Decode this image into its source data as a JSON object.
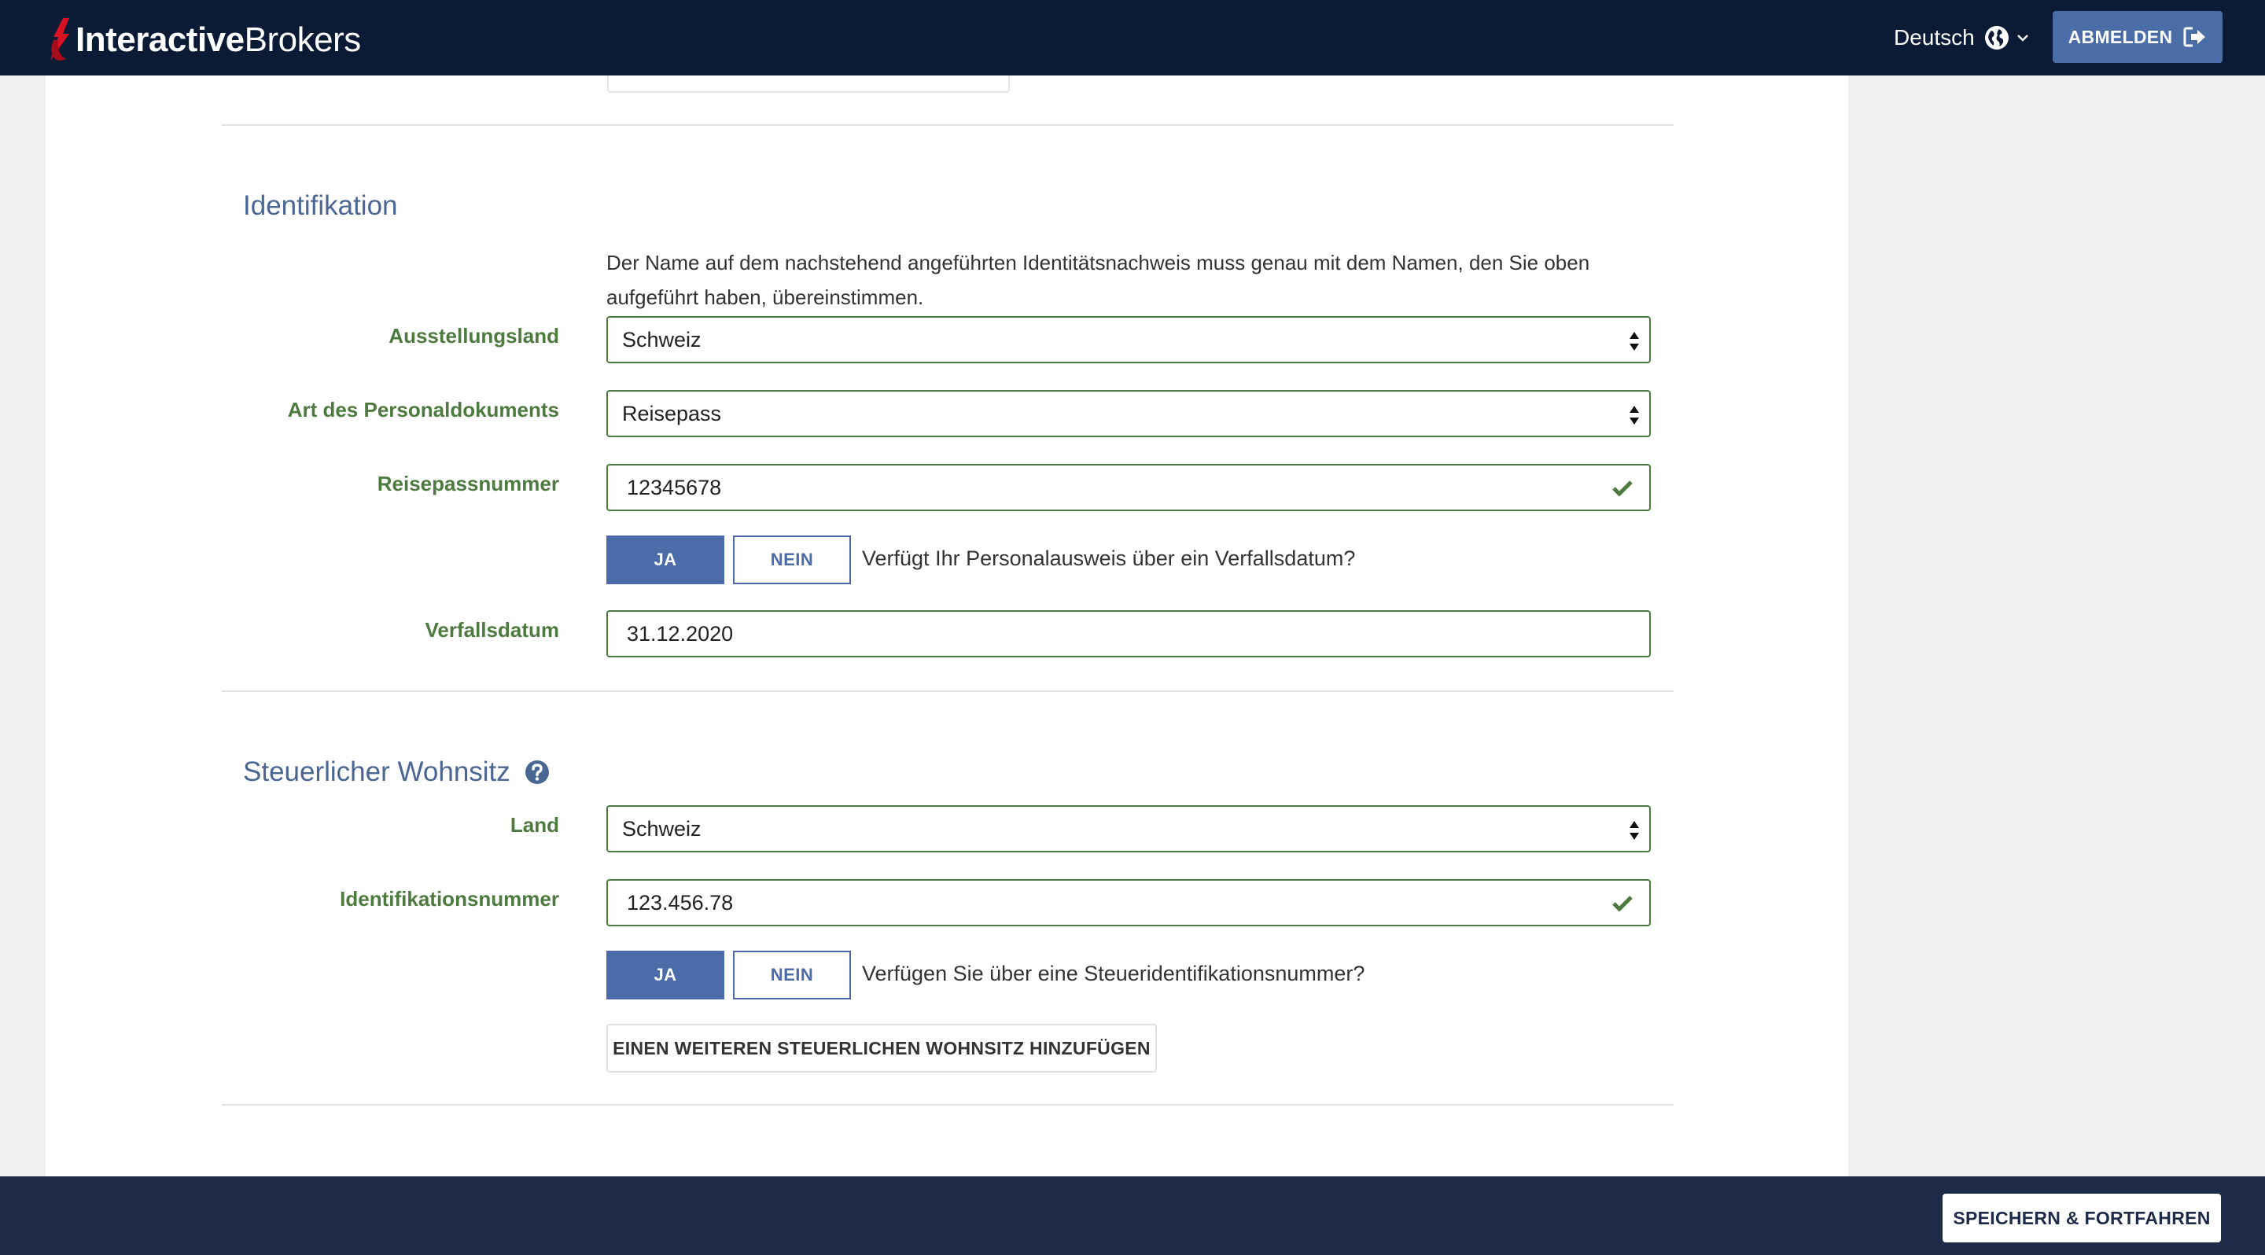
{
  "header": {
    "logo_bold": "Interactive",
    "logo_regular": "Brokers",
    "language": "Deutsch",
    "logout_label": "ABMELDEN"
  },
  "identification": {
    "title": "Identifikation",
    "intro": "Der Name auf dem nachstehend angeführten Identitätsnachweis muss genau mit dem Namen, den Sie oben aufgeführt haben, übereinstimmen.",
    "issuing_country": {
      "label": "Ausstellungsland",
      "value": "Schweiz"
    },
    "document_type": {
      "label": "Art des Personaldokuments",
      "value": "Reisepass"
    },
    "passport_number": {
      "label": "Reisepassnummer",
      "value": "12345678"
    },
    "has_expiry": {
      "yes": "JA",
      "no": "NEIN",
      "question": "Verfügt Ihr Personalausweis über ein Verfallsdatum?",
      "selected": "yes"
    },
    "expiry_date": {
      "label": "Verfallsdatum",
      "value": "31.12.2020"
    }
  },
  "tax_residency": {
    "title": "Steuerlicher Wohnsitz",
    "country": {
      "label": "Land",
      "value": "Schweiz"
    },
    "tin": {
      "label": "Identifikationsnummer",
      "value": "123.456.78"
    },
    "has_tin": {
      "yes": "JA",
      "no": "NEIN",
      "question": "Verfügen Sie über eine Steueridentifikationsnummer?",
      "selected": "yes"
    },
    "add_button": "EINEN WEITEREN STEUERLICHEN WOHNSITZ HINZUFÜGEN"
  },
  "footer": {
    "save_label": "SPEICHERN & FORTFAHREN"
  },
  "colors": {
    "nav_bg": "#0b1a35",
    "footer_bg": "#1d2b48",
    "accent_blue": "#4b6ca8",
    "label_green": "#4d7a3e",
    "logo_red": "#d81222"
  },
  "icons": [
    "ib-logo-icon",
    "globe-icon",
    "chevron-down-icon",
    "logout-icon",
    "help-icon",
    "select-arrows-icon",
    "checkmark-icon"
  ]
}
